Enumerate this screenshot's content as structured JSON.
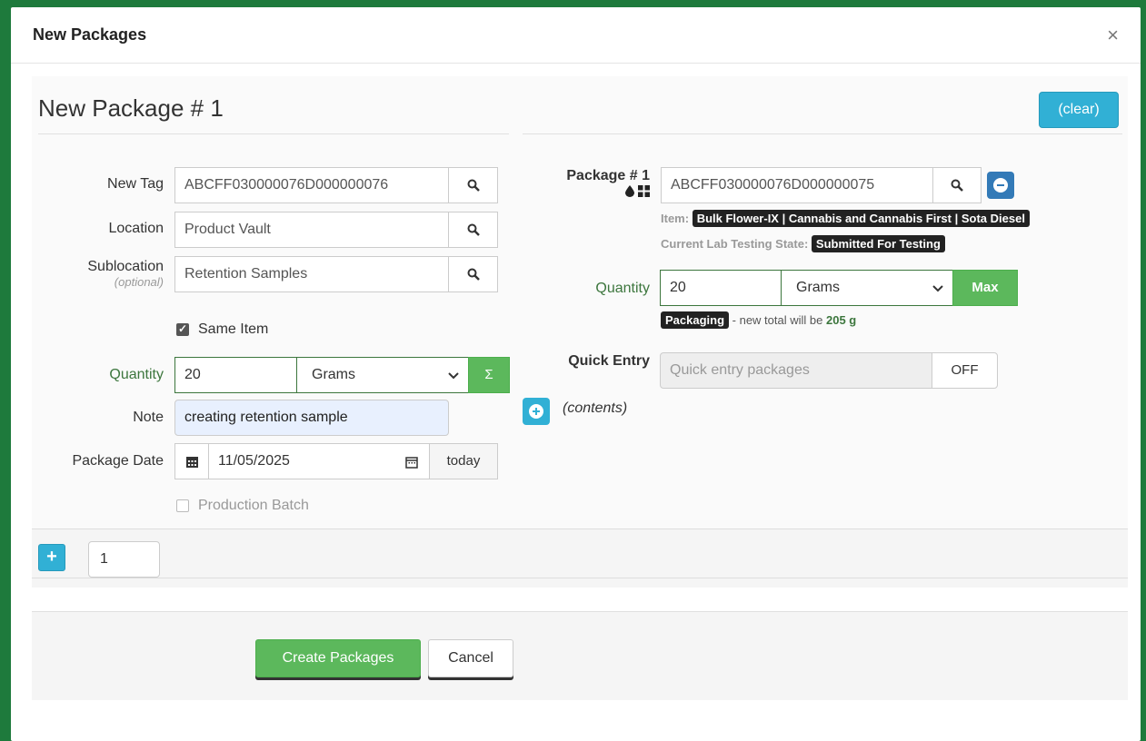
{
  "modal": {
    "title": "New Packages",
    "close": "×"
  },
  "package": {
    "title": "New Package # 1",
    "clear_label": "(clear)"
  },
  "left": {
    "new_tag_label": "New Tag",
    "new_tag_value": "ABCFF030000076D000000076",
    "location_label": "Location",
    "location_value": "Product Vault",
    "sublocation_label": "Sublocation",
    "sublocation_optional": "(optional)",
    "sublocation_value": "Retention Samples",
    "same_item_label": "Same Item",
    "quantity_label": "Quantity",
    "quantity_value": "20",
    "unit_value": "Grams",
    "sigma": "Σ",
    "note_label": "Note",
    "note_value": "creating retention sample",
    "package_date_label": "Package Date",
    "package_date_value": "11/05/2025",
    "today_label": "today",
    "production_batch_label": "Production Batch"
  },
  "right": {
    "package_label": "Package # 1",
    "package_tag_value": "ABCFF030000076D000000075",
    "item_label": "Item:",
    "item_value": "Bulk Flower-IX | Cannabis and Cannabis First | Sota Diesel",
    "lab_label": "Current Lab Testing State:",
    "lab_value": "Submitted For Testing",
    "quantity_label": "Quantity",
    "quantity_value": "20",
    "unit_value": "Grams",
    "max_label": "Max",
    "packaging_badge": "Packaging",
    "new_total_text": "- new total will be",
    "new_total_value": "205 g",
    "quick_entry_label": "Quick Entry",
    "quick_entry_placeholder": "Quick entry packages",
    "off_label": "OFF",
    "contents_label": "(contents)"
  },
  "add_row": {
    "plus": "+",
    "count": "1"
  },
  "footer": {
    "create_label": "Create Packages",
    "cancel_label": "Cancel"
  },
  "colors": {
    "frame": "#1e7a3c",
    "info": "#31b0d5",
    "primary": "#337ab7",
    "success": "#5cb85c",
    "label_green": "#3c763d"
  }
}
